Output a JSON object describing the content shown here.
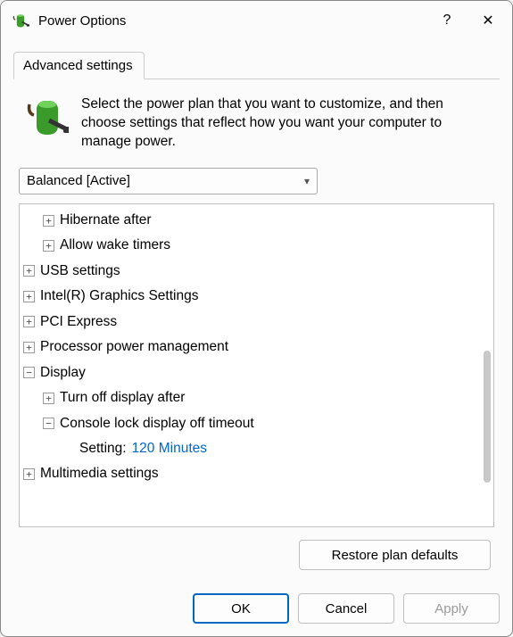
{
  "window": {
    "title": "Power Options",
    "help_glyph": "?",
    "close_glyph": "✕"
  },
  "tabs": {
    "advanced": "Advanced settings"
  },
  "intro": "Select the power plan that you want to customize, and then choose settings that reflect how you want your computer to manage power.",
  "plan_selected": "Balanced [Active]",
  "tree": {
    "hibernate_after": "Hibernate after",
    "allow_wake_timers": "Allow wake timers",
    "usb_settings": "USB settings",
    "intel_graphics": "Intel(R) Graphics Settings",
    "pci_express": "PCI Express",
    "processor_power": "Processor power management",
    "display": "Display",
    "turn_off_display_after": "Turn off display after",
    "console_lock": "Console lock display off timeout",
    "setting_label": "Setting:",
    "setting_value": "120 Minutes",
    "multimedia": "Multimedia settings"
  },
  "buttons": {
    "restore": "Restore plan defaults",
    "ok": "OK",
    "cancel": "Cancel",
    "apply": "Apply"
  }
}
